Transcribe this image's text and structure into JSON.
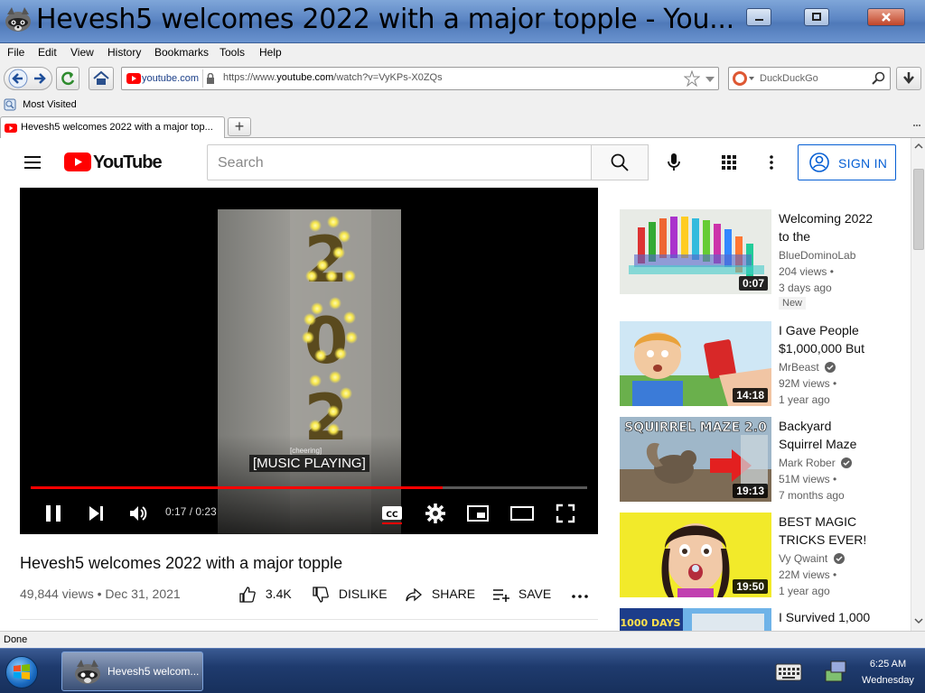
{
  "window": {
    "title": "Hevesh5 welcomes 2022 with a major topple - You...",
    "app_icon": "raccoon-icon"
  },
  "menu": [
    "File",
    "Edit",
    "View",
    "History",
    "Bookmarks",
    "Tools",
    "Help"
  ],
  "nav": {
    "site_chip": "youtube.com",
    "url_prefix": "https://www.",
    "url_domain": "youtube.com",
    "url_suffix": "/watch?v=VyKPs-X0ZQs",
    "search_placeholder": "DuckDuckGo"
  },
  "bookmarks": {
    "most_visited": "Most Visited"
  },
  "tab": {
    "label": "Hevesh5 welcomes 2022 with a major top...",
    "new_tab": "+"
  },
  "youtube": {
    "logo": "YouTube",
    "search_placeholder": "Search",
    "sign_in": "SIGN IN"
  },
  "player": {
    "caption_small": "[cheering]",
    "caption": "[MUSIC PLAYING]",
    "time": "0:17 / 0:23",
    "progress": 0.74,
    "overlay_numbers": [
      "2",
      "0",
      "2"
    ]
  },
  "video": {
    "title": "Hevesh5 welcomes 2022 with a major topple",
    "meta": "49,844 views • Dec 31, 2021",
    "likes": "3.4K",
    "dislike": "DISLIKE",
    "share": "SHARE",
    "save": "SAVE"
  },
  "recommendations": [
    {
      "title": "Welcoming 2022 to the",
      "channel": "BlueDominoLab",
      "views": "204 views •",
      "age": "3 days ago",
      "badge": "New",
      "duration": "0:07",
      "verified": false
    },
    {
      "title": "I Gave People $1,000,000 But",
      "channel": "MrBeast",
      "views": "92M views •",
      "age": "1 year ago",
      "duration": "14:18",
      "verified": true
    },
    {
      "title": "Backyard Squirrel Maze",
      "channel": "Mark Rober",
      "views": "51M views •",
      "age": "7 months ago",
      "duration": "19:13",
      "verified": true,
      "thumb_text": "SQUIRREL MAZE 2.0"
    },
    {
      "title": "BEST MAGIC TRICKS EVER!",
      "channel": "Vy Qwaint",
      "views": "22M views •",
      "age": "1 year ago",
      "duration": "19:50",
      "verified": true
    },
    {
      "title": "I Survived 1,000",
      "thumb_text": "1000 DAYS"
    }
  ],
  "status": "Done",
  "taskbar": {
    "task_label": "Hevesh5 welcom...",
    "time": "6:25 AM",
    "day": "Wednesday"
  },
  "colors": {
    "youtube_red": "#ff0000",
    "link_blue": "#065fd4",
    "taskbar": "#1f3b6e"
  }
}
